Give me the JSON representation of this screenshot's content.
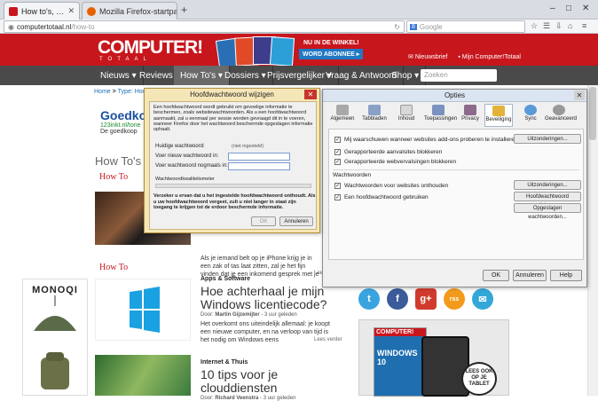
{
  "browser": {
    "tabs": [
      {
        "title": "How to's, handleidingen, u...",
        "active": true
      },
      {
        "title": "Mozilla Firefox-startpagina",
        "active": false
      }
    ],
    "new_tab": "+",
    "url_host": "computertotaal.nl",
    "url_path": "/how-to",
    "search_placeholder": "Google",
    "window_controls": [
      "–",
      "□",
      "✕"
    ]
  },
  "site": {
    "logo": "COMPUTER!",
    "logo_sub": "TOTAAL",
    "promo_line1": "NU IN DE WINKEL!",
    "promo_line2": "WORD ABONNEE ▸",
    "header_links": [
      "Nieuwsbrief",
      "Mijn Computer!Totaal"
    ],
    "menu": [
      "Nieuws ▾",
      "Reviews ▾",
      "How To's ▾",
      "Dossiers ▾",
      "Prijsvergelijker ▾",
      "Vraag & Antwoord",
      "Shop ▾"
    ],
    "menu_search_placeholder": "Zoeken",
    "breadcrumb_home": "Home",
    "breadcrumb_sep": " > ",
    "breadcrumb_current": "Type: How To",
    "ad_title": "Goedkoo",
    "ad_url": "123inkt.nl/tone",
    "ad_text": "De goedkoop",
    "section_title": "How To's",
    "howto_label": "How To",
    "article1_snippet": "Als je iemand belt op je iPhone krijg je in een zak of tas laat zitten, zal je het fijn vinden dat je een inkomend gesprek met je",
    "lees_verder": "Lees verder",
    "article2": {
      "category": "Apps & Software",
      "title": "Hoe achterhaal je mijn Windows licentiecode?",
      "by_label": "Door:",
      "author": "Martin Gijzemijter",
      "ago": " - 3 uur geleden",
      "excerpt": "Het overkomt ons uiteindelijk allemaal: je koopt een nieuwe computer, en na verloop van tijd is het nodig om Windows eens"
    },
    "article3": {
      "category": "Internet & Thuis",
      "title": "10 tips voor je clouddiensten",
      "by_label": "Door:",
      "author": "Richard Veenstra",
      "ago": " - 3 uur geleden"
    },
    "side_ad_brand": "MONOQI",
    "social": [
      "t",
      "f",
      "g+",
      "rss",
      "✉"
    ],
    "magazine_title": "COMPUTER!",
    "magazine_cover": "WINDOWS 10",
    "lees_badge": "LEES OOK OP JE TABLET"
  },
  "options_dialog": {
    "title": "Opties",
    "close": "✕",
    "tabs": [
      "Algemeen",
      "Tabbladen",
      "Inhoud",
      "Toepassingen",
      "Privacy",
      "Beveiliging",
      "Sync",
      "Geavanceerd"
    ],
    "selected_tab": "Beveiliging",
    "rows": [
      {
        "label": "Mij waarschuwen wanneer websites add-ons proberen te installeren",
        "checked": true
      },
      {
        "label": "Gerapporteerde aanvalsites blokkeren",
        "checked": true
      },
      {
        "label": "Gerapporteerde webvervalsingen blokkeren",
        "checked": true
      }
    ],
    "exceptions_btn": "Uitzonderingen...",
    "passwords_group": "Wachtwoorden",
    "pw_rows": [
      {
        "label": "Wachtwoorden voor websites onthouden",
        "checked": true
      },
      {
        "label": "Een hoofdwachtwoord gebruiken",
        "checked": true
      }
    ],
    "exceptions_btn2": "Uitzonderingen...",
    "master_btn": "Hoofdwachtwoord wijzigen...",
    "saved_btn": "Opgeslagen wachtwoorden...",
    "ok": "OK",
    "cancel": "Annuleren",
    "help": "Help"
  },
  "master_dialog": {
    "title": "Hoofdwachtwoord wijzigen",
    "close": "✕",
    "info": "Een hoofdwachtwoord wordt gebruikt om gevoelige informatie te beschermen, zoals websitewachtwoorden. Als u een hoofdwachtwoord aanmaakt, zal u eenmaal per sessie worden gevraagd dit in te voeren, wanneer Firefox door het wachtwoord beschermde opgeslagen informatie ophaalt.",
    "current_label": "Huidige wachtwoord:",
    "current_value": "(niet ingesteld)",
    "new_label": "Voer nieuw wachtwoord in:",
    "repeat_label": "Voer wachtwoord nogmaals in:",
    "meter_label": "Wachtwoordkwaliteitsmeter",
    "meter_level": 0,
    "warning": "Verzeker u ervan dat u het ingestelde hoofdwachtwoord onthoudt. Als u uw hoofdwachtwoord vergeet, zult u niet langer in staat zijn toegang te krijgen tot de erdoor beschermde informatie.",
    "ok": "OK",
    "cancel": "Annuleren"
  }
}
